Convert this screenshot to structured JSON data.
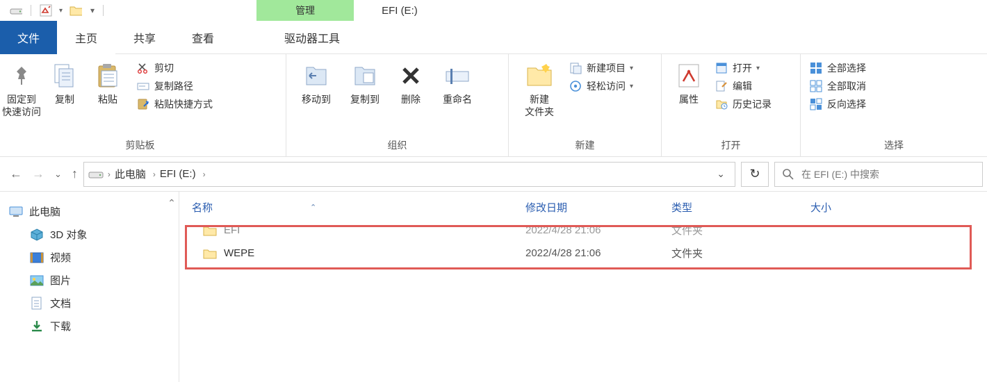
{
  "titlebar": {
    "contextual_tab": "管理",
    "window_title": "EFI (E:)"
  },
  "tabs": {
    "file": "文件",
    "home": "主页",
    "share": "共享",
    "view": "查看",
    "drive_tools": "驱动器工具"
  },
  "ribbon": {
    "clipboard": {
      "pin": "固定到\n快速访问",
      "copy": "复制",
      "paste": "粘贴",
      "cut": "剪切",
      "copy_path": "复制路径",
      "paste_shortcut": "粘贴快捷方式",
      "label": "剪贴板"
    },
    "organize": {
      "move_to": "移动到",
      "copy_to": "复制到",
      "delete": "删除",
      "rename": "重命名",
      "label": "组织"
    },
    "new": {
      "new_folder": "新建\n文件夹",
      "new_item": "新建项目",
      "easy_access": "轻松访问",
      "label": "新建"
    },
    "open": {
      "properties": "属性",
      "open": "打开",
      "edit": "编辑",
      "history": "历史记录",
      "label": "打开"
    },
    "select": {
      "select_all": "全部选择",
      "select_none": "全部取消",
      "invert": "反向选择",
      "label": "选择"
    }
  },
  "address": {
    "this_pc": "此电脑",
    "drive": "EFI (E:)",
    "search_placeholder": "在 EFI (E:) 中搜索"
  },
  "sidebar": {
    "this_pc": "此电脑",
    "objects3d": "3D 对象",
    "videos": "视频",
    "pictures": "图片",
    "documents": "文档",
    "downloads": "下载"
  },
  "columns": {
    "name": "名称",
    "modified": "修改日期",
    "type": "类型",
    "size": "大小"
  },
  "files": [
    {
      "name": "EFI",
      "modified": "2022/4/28 21:06",
      "type": "文件夹"
    },
    {
      "name": "WEPE",
      "modified": "2022/4/28 21:06",
      "type": "文件夹"
    }
  ]
}
